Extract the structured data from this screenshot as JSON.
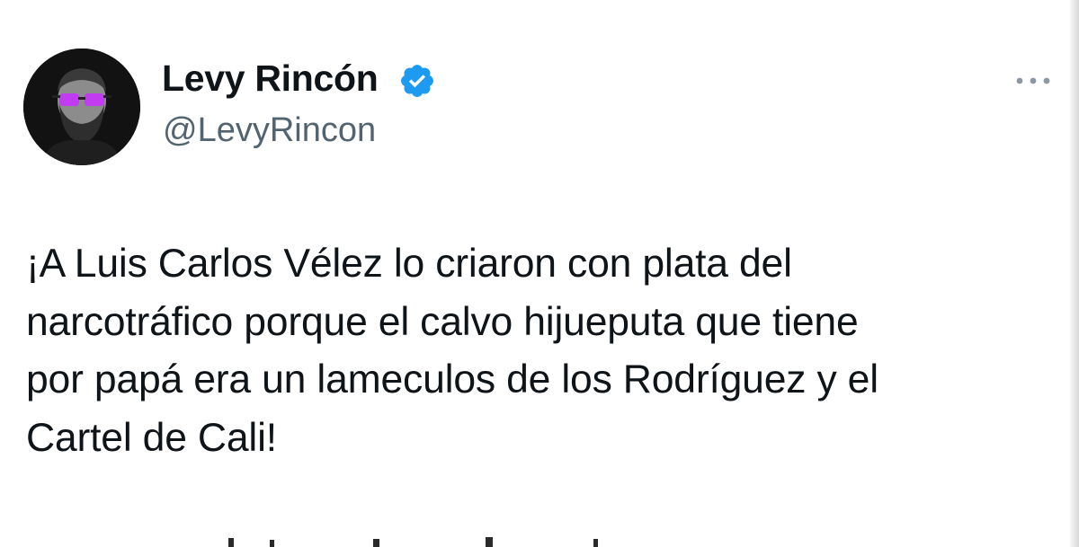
{
  "tweet": {
    "author": {
      "display_name": "Levy Rincón",
      "handle": "@LevyRincon",
      "verified": true,
      "avatar_icon": "profile-photo-bearded-man-purple-glasses"
    },
    "more_icon": "ellipsis-icon",
    "text_lines": [
      "¡A Luis Carlos Vélez lo criaron con plata del",
      "narcotráfico porque el calvo hijueputa que tiene",
      "por papá era un lameculos de los Rodríguez y el",
      "Cartel de Cali!"
    ]
  },
  "colors": {
    "text_primary": "#0f1419",
    "text_secondary": "#536471",
    "verified_blue": "#1d9bf0",
    "glasses_purple": "#c13cf0"
  }
}
